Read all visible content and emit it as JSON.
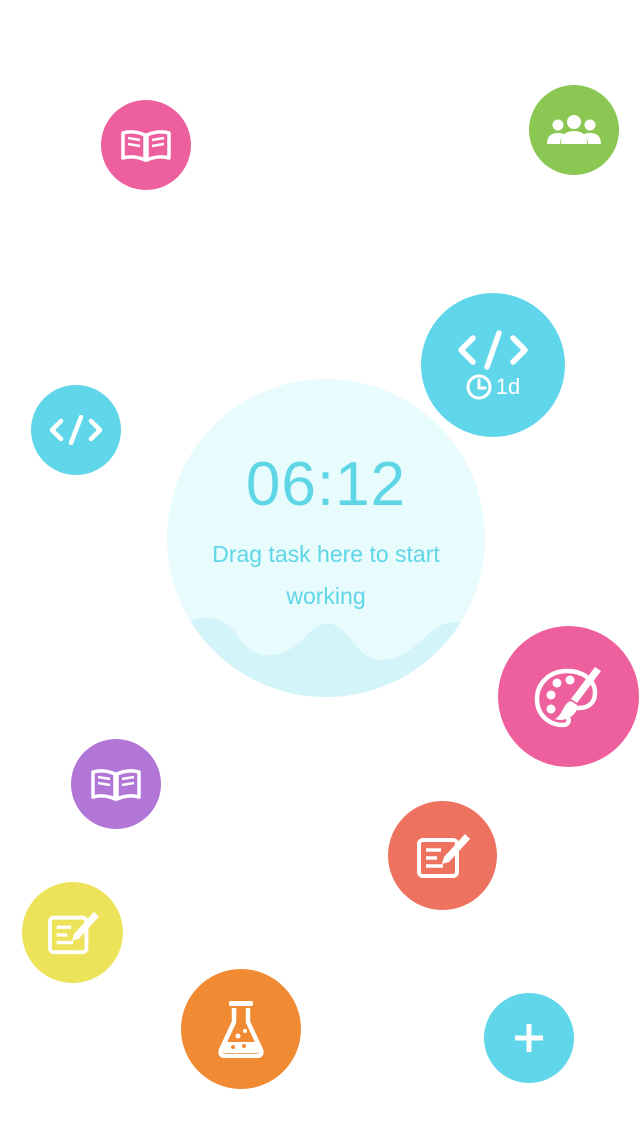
{
  "timer": {
    "time": "06:12",
    "hint": "Drag task here to start working"
  },
  "tasks": [
    {
      "id": "reading-pink",
      "icon": "book-icon",
      "color": "#ee5f9e"
    },
    {
      "id": "team-green",
      "icon": "group-icon",
      "color": "#8bc753"
    },
    {
      "id": "coding-blue-due",
      "icon": "code-icon",
      "color": "#5fd6e9",
      "due": "1d",
      "due_icon": "clock-icon"
    },
    {
      "id": "coding-blue",
      "icon": "code-icon",
      "color": "#5fd6e9"
    },
    {
      "id": "art-pink",
      "icon": "palette-icon",
      "color": "#ee5f9e"
    },
    {
      "id": "reading-purple",
      "icon": "book-icon",
      "color": "#b276d6"
    },
    {
      "id": "writing-red",
      "icon": "edit-icon",
      "color": "#ee7260"
    },
    {
      "id": "writing-yellow",
      "icon": "edit-icon",
      "color": "#ede35b"
    },
    {
      "id": "science-orange",
      "icon": "flask-icon",
      "color": "#f08a33"
    }
  ],
  "add_button": {
    "icon": "plus-icon",
    "color": "#5fd6e9"
  }
}
